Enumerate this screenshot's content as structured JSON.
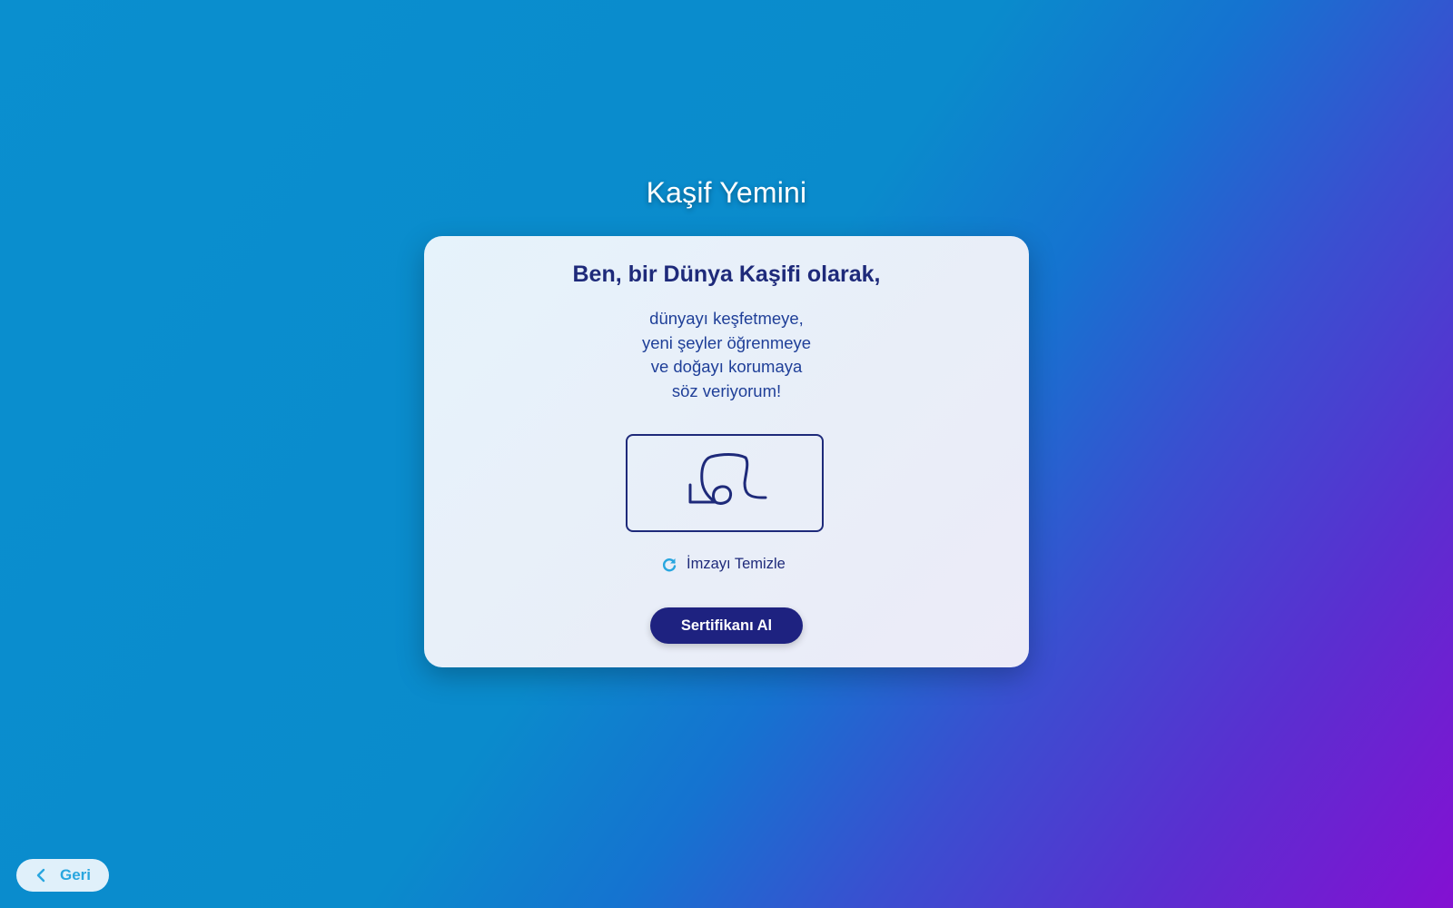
{
  "page": {
    "title": "Kaşif Yemini"
  },
  "oath": {
    "heading": "Ben, bir Dünya Kaşifi olarak,",
    "lines": [
      "dünyayı keşfetmeye,",
      "yeni şeyler öğrenmeye",
      "ve doğayı korumaya",
      "söz veriyorum!"
    ]
  },
  "signature": {
    "clear_label": "İmzayı Temizle",
    "clear_icon": "refresh-icon"
  },
  "actions": {
    "certificate_label": "Sertifikanı Al",
    "back_label": "Geri",
    "back_icon": "chevron-left-icon"
  },
  "colors": {
    "primary": "#1e2280",
    "heading": "#1e2a7a",
    "accent": "#29a6df",
    "gradient_start": "#0a8fcf",
    "gradient_end": "#8410d2"
  }
}
